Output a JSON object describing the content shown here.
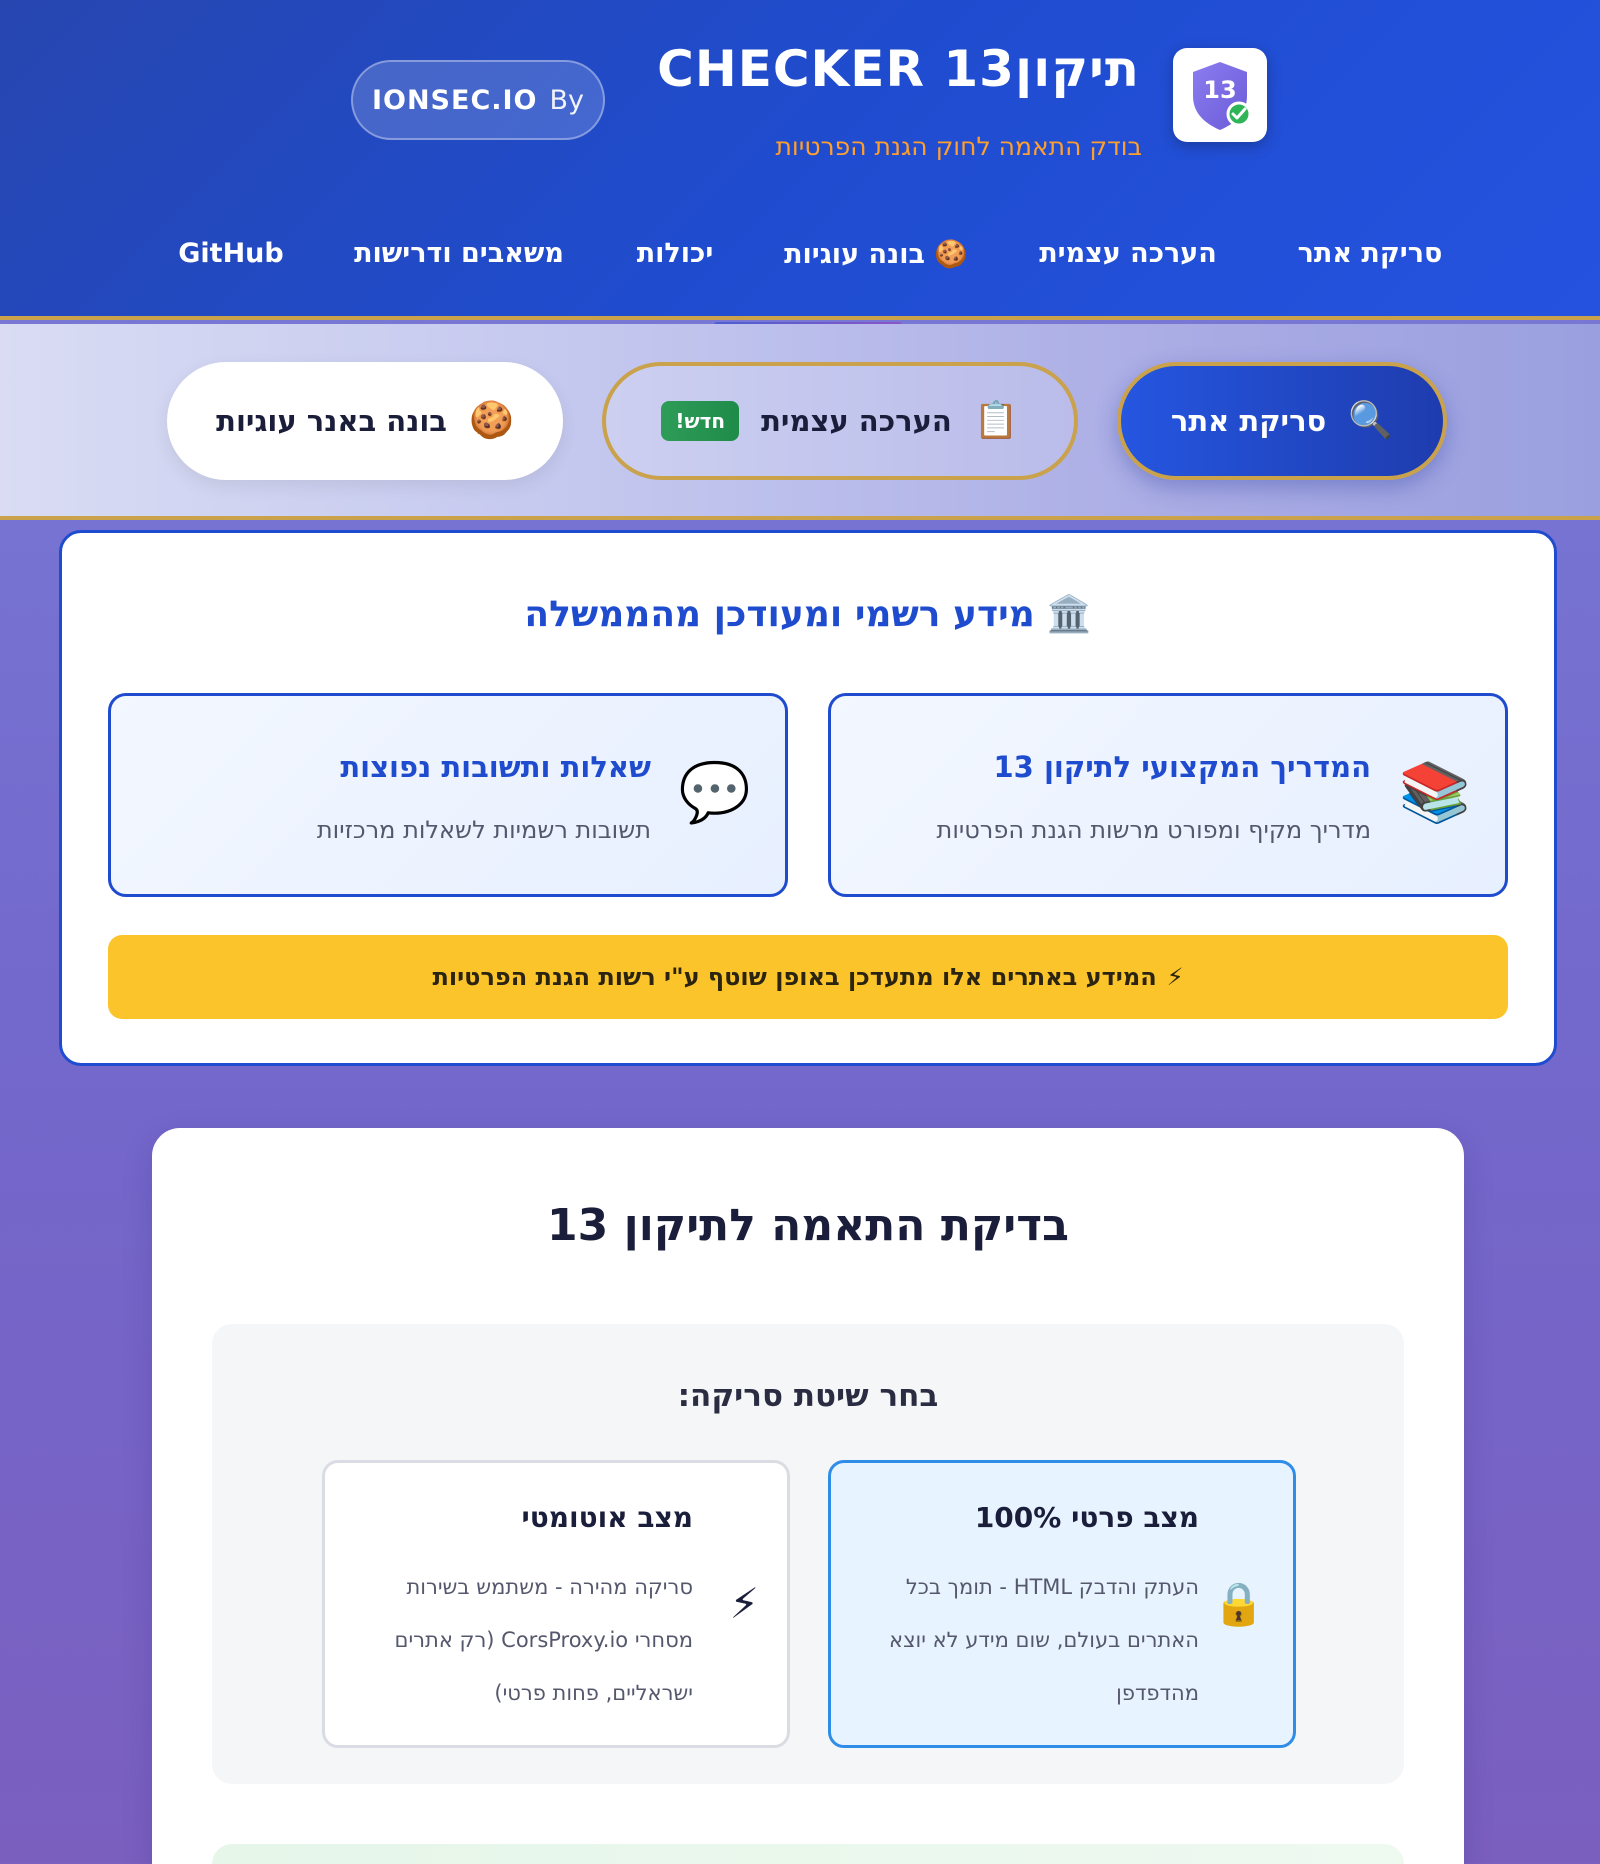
{
  "brand": {
    "title": "תיקון13 CHECKER",
    "subtitle": "בודק התאמה לחוק הגנת הפרטיות",
    "logo_number": "13",
    "by_word": "By",
    "by_brand": "IONSEC.IO",
    "colors": {
      "primary": "#1f4ccf",
      "accent": "#c9a24b",
      "subtitle": "#ff9f2e"
    }
  },
  "nav": {
    "items": [
      {
        "label": "סריקת אתר"
      },
      {
        "label": "הערכה עצמית"
      },
      {
        "label": "🍪 בונה עוגיות"
      },
      {
        "label": "יכולות"
      },
      {
        "label": "משאבים ודרישות"
      },
      {
        "label": "GitHub"
      }
    ]
  },
  "toolbar": {
    "scan": {
      "label": "סריקת אתר",
      "icon": "magnifier-icon"
    },
    "self": {
      "label": "הערכה עצמית",
      "icon": "clipboard-icon",
      "badge": "חדש!"
    },
    "cookie": {
      "label": "בונה באנר עוגיות",
      "icon": "cookie-icon"
    }
  },
  "gov": {
    "title": "מידע רשמי ומעודכן מהממשלה",
    "title_icon": "classical-building-icon",
    "guide": {
      "title": "המדריך המקצועי לתיקון 13",
      "desc": "מדריך מקיף ומפורט מרשות הגנת הפרטיות",
      "icon": "books-icon"
    },
    "faq": {
      "title": "שאלות ותשובות נפוצות",
      "desc": "תשובות רשמיות לשאלות מרכזיות",
      "icon": "speech-bubble-icon"
    },
    "notice": "המידע באתרים אלו מתעדכן באופן שוטף ע\"י רשות הגנת הפרטיות",
    "notice_icon": "lightning-icon"
  },
  "check": {
    "title": "בדיקת התאמה לתיקון 13",
    "method_label": "בחר שיטת סריקה:",
    "modes": {
      "private": {
        "title": "מצב פרטי 100%",
        "desc": "העתק והדבק HTML - תומך בכל האתרים בעולם, שום מידע לא יוצא מהדפדפן",
        "icon": "lock-icon",
        "selected": true
      },
      "auto": {
        "title": "מצב אוטומטי",
        "desc": "סריקה מהירה - משתמש בשירות מסחרי CorsProxy.io (רק אתרים ישראליים, פחות פרטי)",
        "icon": "lightning-icon",
        "selected": false
      }
    }
  }
}
